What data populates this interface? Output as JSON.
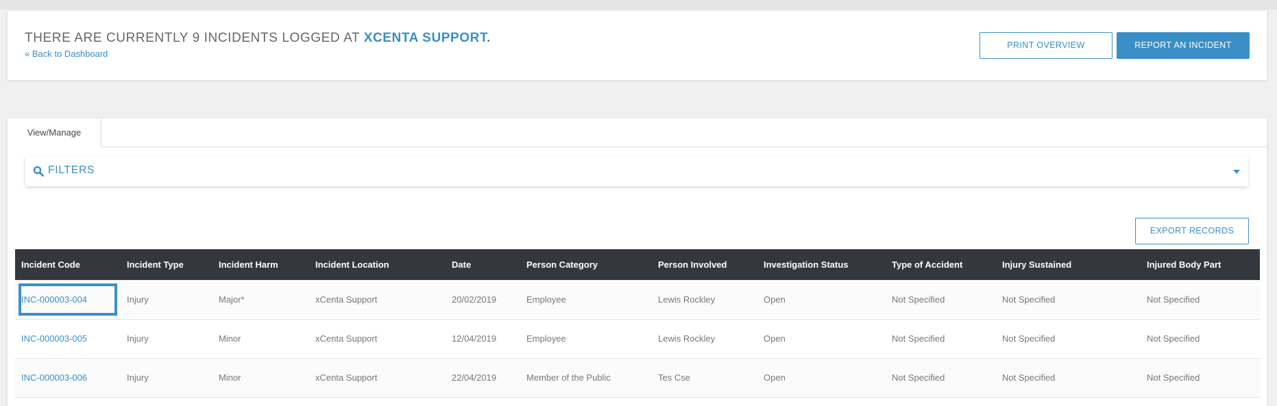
{
  "header": {
    "headline_prefix": "THERE ARE CURRENTLY 9 INCIDENTS LOGGED AT",
    "org_name": "XCENTA SUPPORT.",
    "back_link": "« Back to Dashboard",
    "print_button": "PRINT OVERVIEW",
    "report_button": "REPORT AN INCIDENT"
  },
  "tabs": [
    {
      "label": "View/Manage",
      "active": true
    }
  ],
  "filters": {
    "label": "FILTERS",
    "icon": "search-icon",
    "toggle_icon": "caret-down-icon"
  },
  "export_button": "EXPORT RECORDS",
  "table": {
    "columns": [
      "Incident Code",
      "Incident Type",
      "Incident Harm",
      "Incident Location",
      "Date",
      "Person Category",
      "Person Involved",
      "Investigation Status",
      "Type of Accident",
      "Injury Sustained",
      "Injured Body Part"
    ],
    "rows": [
      [
        "INC-000003-004",
        "Injury",
        "Major*",
        "xCenta Support",
        "20/02/2019",
        "Employee",
        "Lewis Rockley",
        "Open",
        "Not Specified",
        "Not Specified",
        "Not Specified"
      ],
      [
        "INC-000003-005",
        "Injury",
        "Minor",
        "xCenta Support",
        "12/04/2019",
        "Employee",
        "Lewis Rockley",
        "Open",
        "Not Specified",
        "Not Specified",
        "Not Specified"
      ],
      [
        "INC-000003-006",
        "Injury",
        "Minor",
        "xCenta Support",
        "22/04/2019",
        "Member of the Public",
        "Tes Cse",
        "Open",
        "Not Specified",
        "Not Specified",
        "Not Specified"
      ]
    ]
  },
  "colors": {
    "accent": "#3a8fc6",
    "table_header_bg": "#34383e",
    "page_bg": "#f0f0f0"
  }
}
